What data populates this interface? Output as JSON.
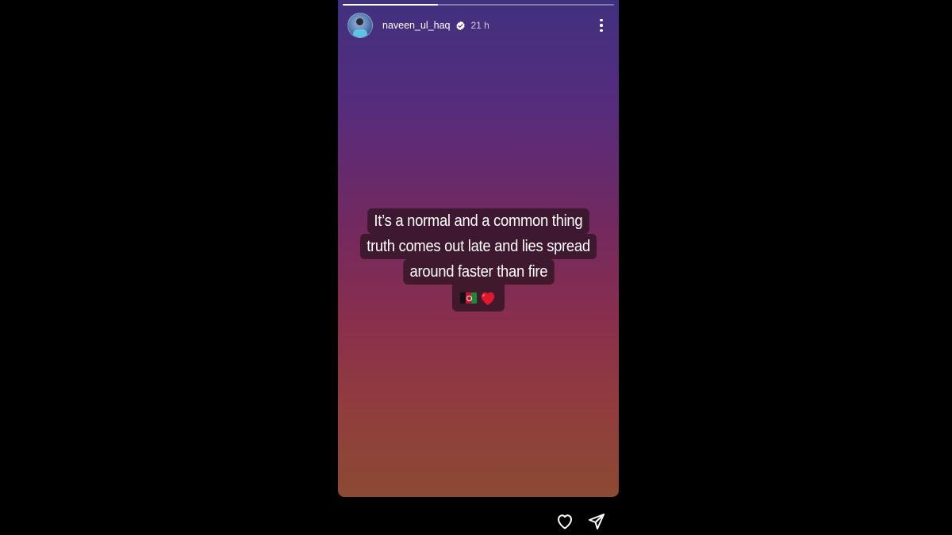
{
  "story": {
    "progress_fraction": 0.35,
    "user": {
      "username": "naveen_ul_haq",
      "verified": true,
      "time_ago": "21 h"
    },
    "caption_lines": [
      "It’s a normal and a common thing",
      "truth comes out late and lies spread",
      "around faster than fire"
    ],
    "emoji": [
      "afghanistan-flag",
      "red-heart"
    ]
  },
  "colors": {
    "background": "#000000",
    "gradient_top": "#40317f",
    "gradient_bottom": "#8b4a33",
    "caption_bg": "#28121e"
  },
  "actions": {
    "like_icon": "heart-outline-icon",
    "share_icon": "send-icon"
  }
}
